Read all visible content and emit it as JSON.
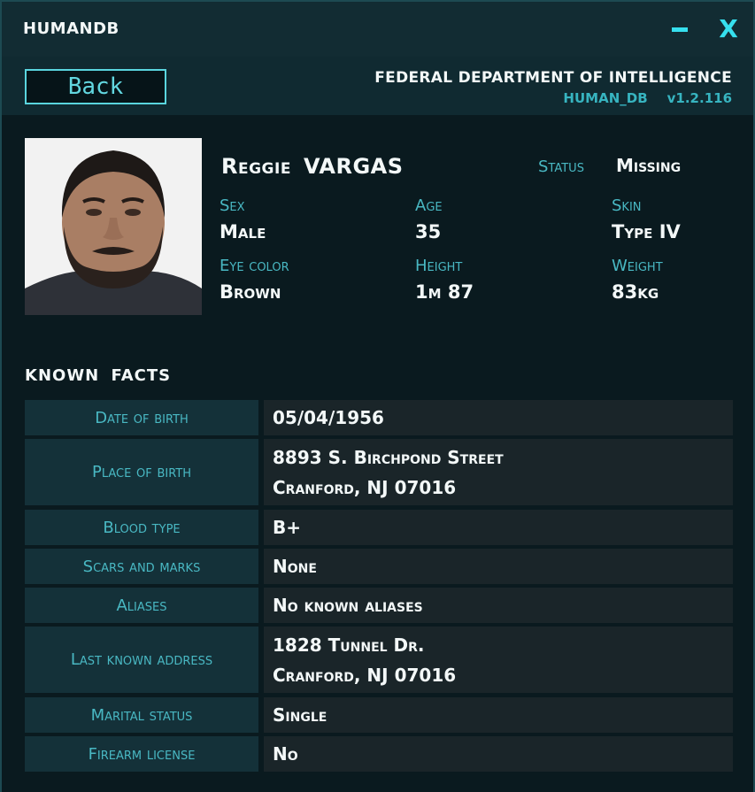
{
  "window": {
    "title": "HUMANDB",
    "minimize_label": "–",
    "close_label": "X",
    "accent_color": "#36e0ee"
  },
  "header": {
    "back_label": "Back",
    "agency": "FEDERAL DEPARTMENT OF INTELLIGENCE",
    "db_name": "HUMAN_DB",
    "version": "v1.2.116"
  },
  "profile": {
    "first_name": "Reggie",
    "last_name": "VARGAS",
    "status_label": "Status",
    "status_value": "Missing",
    "attributes": [
      {
        "label": "Sex",
        "value": "Male"
      },
      {
        "label": "Age",
        "value": "35"
      },
      {
        "label": "Skin",
        "value": "Type IV"
      },
      {
        "label": "Eye color",
        "value": "Brown"
      },
      {
        "label": "Height",
        "value": "1m 87"
      },
      {
        "label": "Weight",
        "value": "83kg"
      }
    ]
  },
  "known_facts": {
    "title": "KNOWN FACTS",
    "rows": [
      {
        "label": "Date of birth",
        "lines": [
          "05/04/1956"
        ]
      },
      {
        "label": "Place of birth",
        "lines": [
          "8893 S. Birchpond Street",
          "Cranford, NJ 07016"
        ]
      },
      {
        "label": "Blood type",
        "lines": [
          "B+"
        ]
      },
      {
        "label": "Scars and marks",
        "lines": [
          "None"
        ]
      },
      {
        "label": "Aliases",
        "lines": [
          "No known aliases"
        ]
      },
      {
        "label": "Last known address",
        "lines": [
          "1828 Tunnel Dr.",
          "Cranford, NJ 07016"
        ]
      },
      {
        "label": "Marital status",
        "lines": [
          "Single"
        ]
      },
      {
        "label": "Firearm license",
        "lines": [
          "No"
        ]
      }
    ]
  }
}
